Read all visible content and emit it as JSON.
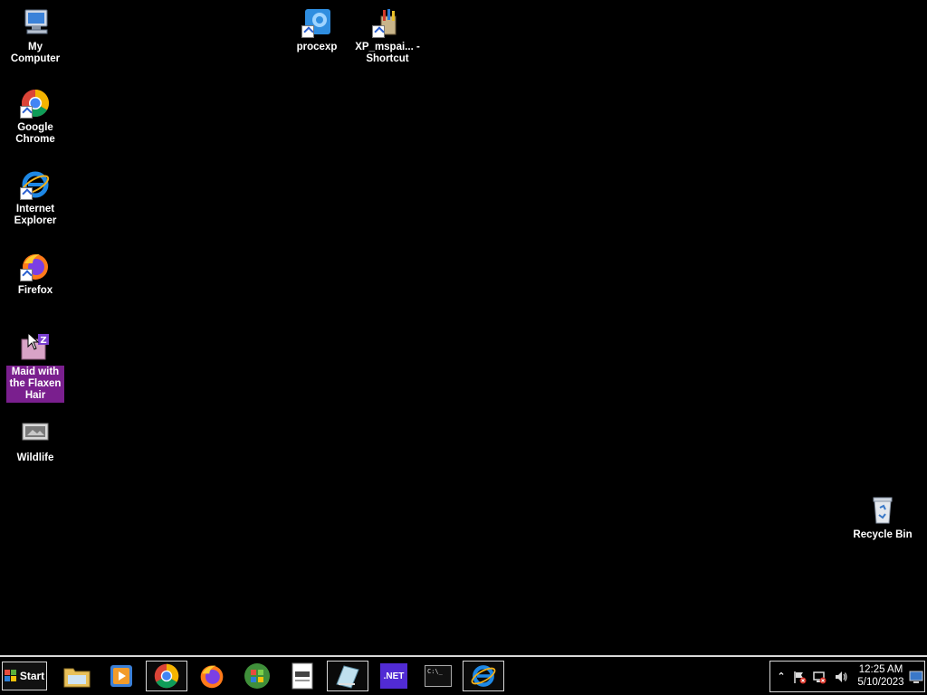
{
  "desktop": {
    "icons": [
      {
        "label": "My Computer",
        "icon": "computer-icon"
      },
      {
        "label": "Google Chrome",
        "icon": "chrome-icon"
      },
      {
        "label": "Internet Explorer",
        "icon": "ie-icon"
      },
      {
        "label": "Firefox",
        "icon": "firefox-icon"
      },
      {
        "label": "Maid with the Flaxen Hair",
        "icon": "audio-file-icon",
        "selected": true
      },
      {
        "label": "Wildlife",
        "icon": "video-file-icon"
      },
      {
        "label": "procexp",
        "icon": "procexp-icon"
      },
      {
        "label": "XP_mspai... - Shortcut",
        "icon": "paint-icon"
      },
      {
        "label": "Recycle Bin",
        "icon": "recycle-bin-icon"
      }
    ]
  },
  "taskbar": {
    "start_label": "Start",
    "pinned": [
      {
        "name": "file-explorer",
        "icon": "folder-icon"
      },
      {
        "name": "media-player",
        "icon": "media-player-icon"
      },
      {
        "name": "chrome",
        "icon": "chrome-icon",
        "active": true
      },
      {
        "name": "firefox",
        "icon": "firefox-icon"
      },
      {
        "name": "windows-media-center",
        "icon": "windows-logo-icon"
      },
      {
        "name": "notepad",
        "icon": "document-icon"
      },
      {
        "name": "paint-window",
        "icon": "paint-brush-icon",
        "active": true
      },
      {
        "name": "dotnet",
        "icon": "dotnet-icon",
        "label": ".NET"
      },
      {
        "name": "cmd",
        "icon": "cmd-icon",
        "label": "C:\\_"
      },
      {
        "name": "internet-explorer",
        "icon": "ie-icon",
        "active": true
      }
    ],
    "tray": {
      "time": "12:25 AM",
      "date": "5/10/2023"
    }
  },
  "colors": {
    "desktop_background": "#000000",
    "selection": "#7a1f8e",
    "dotnet": "#512bd4"
  }
}
